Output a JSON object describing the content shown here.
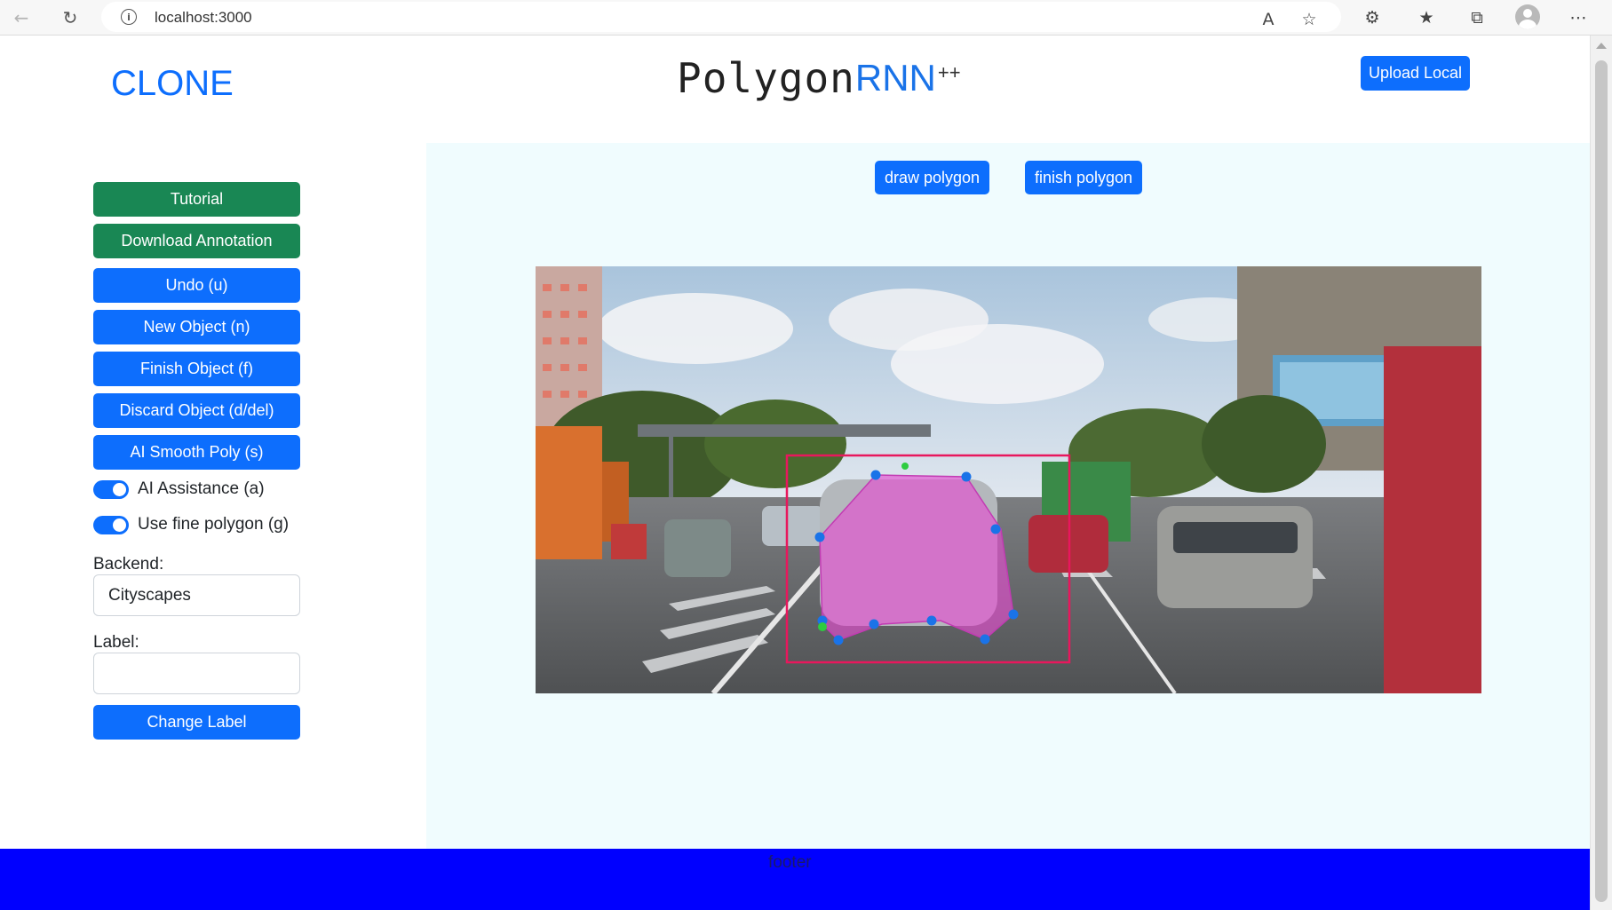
{
  "browser": {
    "url": "localhost:3000"
  },
  "header": {
    "clone_title": "CLONE",
    "logo_text": "Polygon",
    "logo_accent": "RNN",
    "logo_suffix": "++",
    "upload_label": "Upload Local"
  },
  "sidebar": {
    "buttons": [
      {
        "label": "Tutorial",
        "style": "success"
      },
      {
        "label": "Download Annotation",
        "style": "success"
      },
      {
        "label": "Undo (u)",
        "style": "primary"
      },
      {
        "label": "New Object (n)",
        "style": "primary"
      },
      {
        "label": "Finish Object (f)",
        "style": "primary"
      },
      {
        "label": "Discard Object (d/del)",
        "style": "primary"
      },
      {
        "label": "AI Smooth Poly (s)",
        "style": "primary"
      }
    ],
    "toggles": [
      {
        "label": "AI Assistance (a)",
        "checked": true
      },
      {
        "label": "Use fine polygon (g)",
        "checked": true
      }
    ],
    "backend_label": "Backend:",
    "backend_value": "Cityscapes",
    "label_label": "Label:",
    "label_value": "",
    "change_label_button": "Change Label"
  },
  "toolbar": {
    "draw_label": "draw polygon",
    "finish_label": "finish polygon"
  },
  "annotation": {
    "bbox_color": "#e8175d",
    "polygon_fill": "#e44fd0",
    "vertex_color": "#1a73e8",
    "start_vertex_color": "#2ecc40"
  },
  "footer": {
    "text": "footer"
  },
  "colors": {
    "primary": "#0d6efd",
    "success": "#198754",
    "canvas_bg": "#f0fcfe",
    "footer_bg": "#0000ff"
  }
}
